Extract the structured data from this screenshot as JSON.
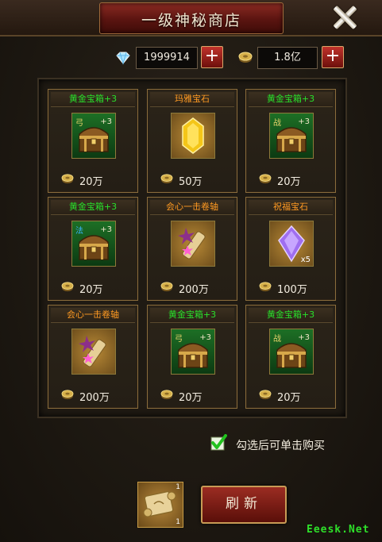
{
  "window": {
    "title": "一级神秘商店",
    "close_icon": "close-icon"
  },
  "currency": {
    "diamonds": "1999914",
    "gold": "1.8亿",
    "diamond_plus": "+",
    "gold_plus": "+"
  },
  "items": [
    {
      "name": "黄金宝箱+3",
      "tag": "弓",
      "plus": "+3",
      "count": "",
      "price": "20万",
      "kind": "chest",
      "name_color": "green",
      "icon": "treasure-chest-icon"
    },
    {
      "name": "玛雅宝石",
      "tag": "",
      "plus": "",
      "count": "",
      "price": "50万",
      "kind": "gem-yellow",
      "name_color": "orange",
      "icon": "gem-icon"
    },
    {
      "name": "黄金宝箱+3",
      "tag": "战",
      "plus": "+3",
      "count": "",
      "price": "20万",
      "kind": "chest",
      "name_color": "green",
      "icon": "treasure-chest-icon"
    },
    {
      "name": "黄金宝箱+3",
      "tag": "法",
      "plus": "+3",
      "count": "",
      "price": "20万",
      "kind": "chest",
      "name_color": "green",
      "icon": "treasure-chest-icon"
    },
    {
      "name": "会心一击卷轴",
      "tag": "",
      "plus": "",
      "count": "",
      "price": "200万",
      "kind": "scroll",
      "name_color": "orange",
      "icon": "scroll-icon"
    },
    {
      "name": "祝福宝石",
      "tag": "",
      "plus": "",
      "count": "x5",
      "price": "100万",
      "kind": "gem-purple",
      "name_color": "orange",
      "icon": "gem-icon"
    },
    {
      "name": "会心一击卷轴",
      "tag": "",
      "plus": "",
      "count": "",
      "price": "200万",
      "kind": "scroll",
      "name_color": "orange",
      "icon": "scroll-icon"
    },
    {
      "name": "黄金宝箱+3",
      "tag": "弓",
      "plus": "+3",
      "count": "",
      "price": "20万",
      "kind": "chest",
      "name_color": "green",
      "icon": "treasure-chest-icon"
    },
    {
      "name": "黄金宝箱+3",
      "tag": "战",
      "plus": "+3",
      "count": "",
      "price": "20万",
      "kind": "chest",
      "name_color": "green",
      "icon": "treasure-chest-icon"
    }
  ],
  "options": {
    "quick_buy_label": "勾选后可单击购买",
    "quick_buy_checked": true
  },
  "refresh": {
    "item_count_top": "1",
    "item_count_bottom": "1",
    "button_label": "刷新"
  },
  "watermark": "Eeesk.Net",
  "colors": {
    "name_green": "#28e12b",
    "name_orange": "#ff9a22",
    "accent_red": "#9b2c22",
    "frame_gold": "#8a6d3c"
  }
}
